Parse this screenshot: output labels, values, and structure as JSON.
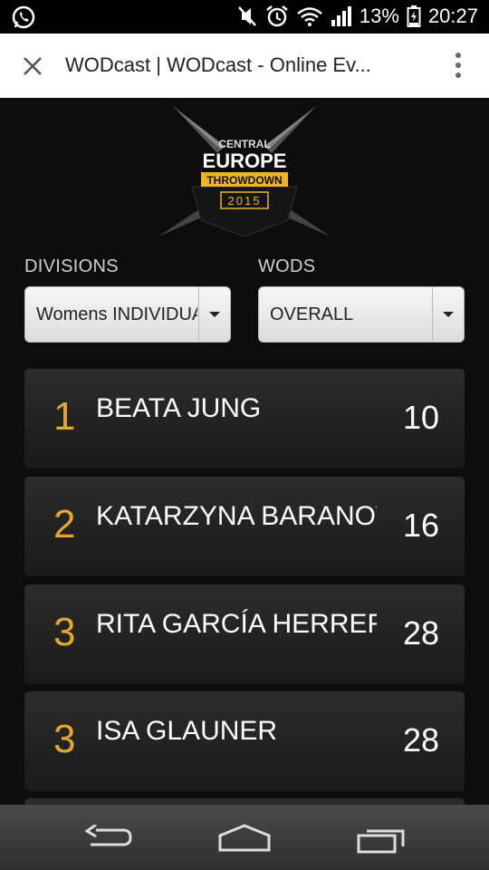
{
  "status_bar": {
    "battery": "13%",
    "time": "20:27",
    "icons": [
      "whatsapp-icon",
      "mute-icon",
      "alarm-icon",
      "wifi-icon",
      "signal-icon",
      "battery-charging-icon"
    ]
  },
  "browser": {
    "title": "WODcast | WODcast - Online Ev...",
    "close_icon": "close-icon",
    "menu_icon": "overflow-menu-icon"
  },
  "logo": {
    "line1": "CENTRAL",
    "line2": "EUROPE",
    "line3": "THROWDOWN",
    "line4": "2015"
  },
  "filters": {
    "divisions_label": "DIVISIONS",
    "divisions_value": "Womens INDIVIDUAL",
    "wods_label": "WODS",
    "wods_value": "OVERALL"
  },
  "leaderboard": [
    {
      "rank": "1",
      "name": "BEATA JUNG",
      "points": "10"
    },
    {
      "rank": "2",
      "name": "KATARZYNA BARANOWSKA",
      "points": "16"
    },
    {
      "rank": "3",
      "name": "RITA GARCÍA HERRERA",
      "points": "28"
    },
    {
      "rank": "3",
      "name": "ISA GLAUNER",
      "points": "28"
    }
  ],
  "nav_bar": {
    "icons": [
      "back-icon",
      "home-icon",
      "recent-apps-icon"
    ]
  },
  "colors": {
    "accent": "#e5a630",
    "card": "#262626",
    "background": "#0d0d0d"
  }
}
